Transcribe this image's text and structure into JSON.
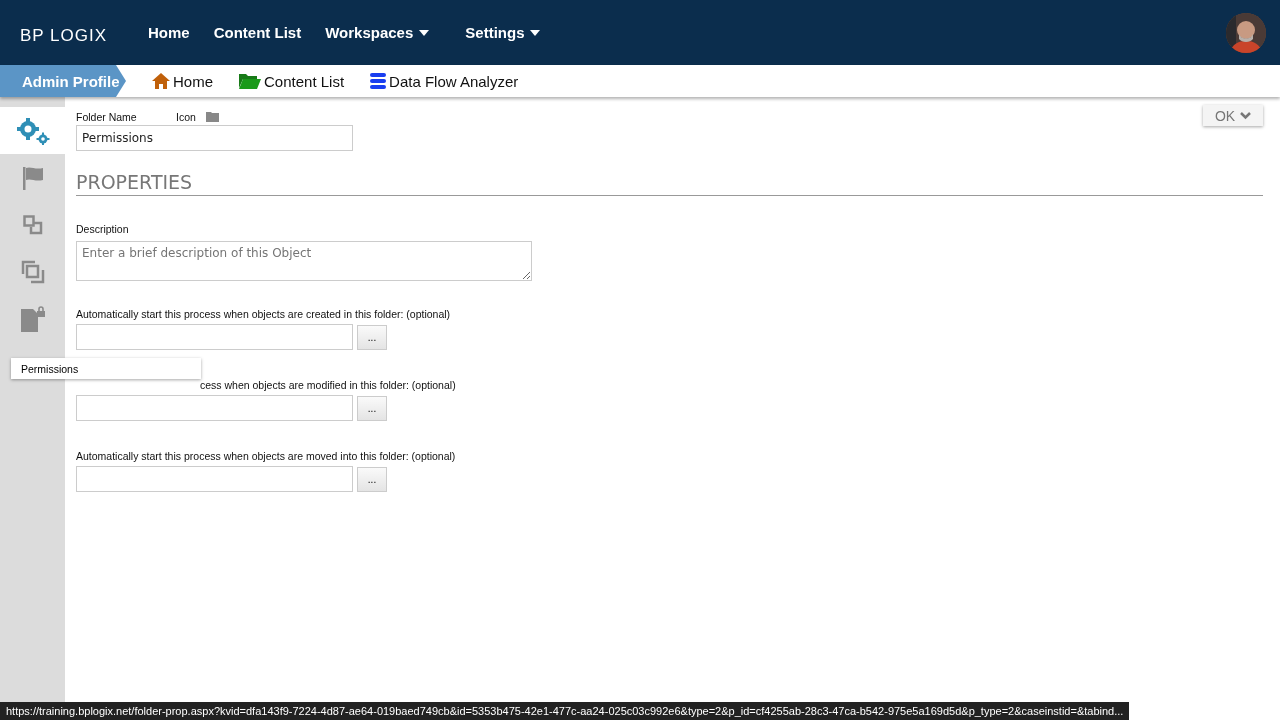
{
  "topnav": {
    "logo": "BP LOGIX",
    "items": [
      {
        "label": "Home",
        "dropdown": false
      },
      {
        "label": "Content List",
        "dropdown": false
      },
      {
        "label": "Workspaces",
        "dropdown": true
      },
      {
        "label": "Settings",
        "dropdown": true
      }
    ]
  },
  "breadcrumb": {
    "profile": "Admin Profile",
    "links": [
      {
        "label": "Home",
        "kind": "home"
      },
      {
        "label": "Content List",
        "kind": "folder"
      },
      {
        "label": "Data Flow Analyzer",
        "kind": "database"
      }
    ]
  },
  "sidebar": {
    "items": [
      {
        "kind": "gears",
        "selected": true
      },
      {
        "kind": "flag",
        "selected": false
      },
      {
        "kind": "linked",
        "selected": false
      },
      {
        "kind": "overlap",
        "selected": false
      },
      {
        "kind": "lock",
        "selected": false
      }
    ],
    "tooltip": "Permissions"
  },
  "ok_button": "OK",
  "form": {
    "folder_name_label": "Folder Name",
    "icon_label": "Icon",
    "folder_name": "Permissions",
    "section": "PROPERTIES",
    "description_label": "Description",
    "description_placeholder": "Enter a brief description of this Object",
    "processes": [
      {
        "label": "Automatically start this process when objects are created in this folder: (optional)",
        "button": "...",
        "kind": "full"
      },
      {
        "label": "cess when objects are modified in this folder: (optional)",
        "button": "...",
        "kind": "partial"
      },
      {
        "label": "Automatically start this process when objects are moved into this folder: (optional)",
        "button": "...",
        "kind": "full"
      }
    ]
  },
  "status_url": "https://training.bplogix.net/folder-prop.aspx?kvid=dfa143f9-7224-4d87-ae64-019baed749cb&id=5353b475-42e1-477c-aa24-025c03c992e6&type=2&p_id=cf4255ab-28c3-47ca-b542-975e5a169d5d&p_type=2&caseinstid=&tabind..."
}
